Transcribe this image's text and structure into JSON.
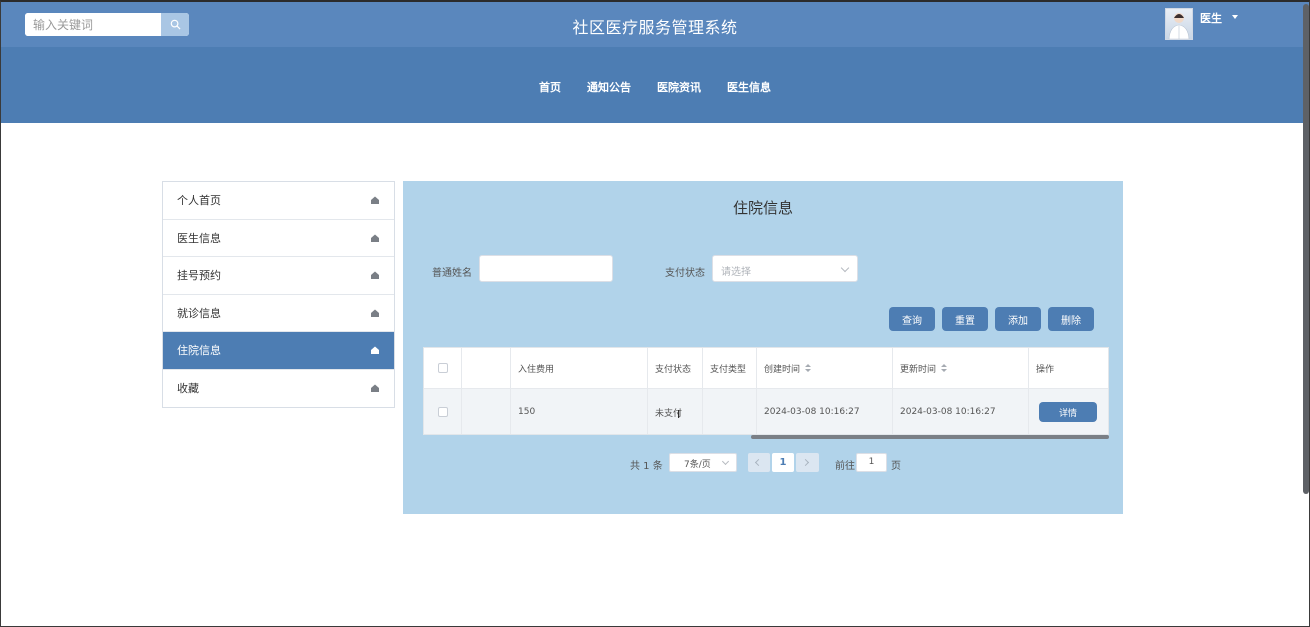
{
  "header": {
    "search_placeholder": "输入关键词",
    "site_title": "社区医疗服务管理系统",
    "user_name": "医生"
  },
  "nav": {
    "items": [
      "首页",
      "通知公告",
      "医院资讯",
      "医生信息"
    ]
  },
  "sidebar": {
    "items": [
      {
        "label": "个人首页",
        "active": false
      },
      {
        "label": "医生信息",
        "active": false
      },
      {
        "label": "挂号预约",
        "active": false
      },
      {
        "label": "就诊信息",
        "active": false
      },
      {
        "label": "住院信息",
        "active": true
      },
      {
        "label": "收藏",
        "active": false
      }
    ]
  },
  "main": {
    "title": "住院信息",
    "filters": {
      "name_label": "普通姓名",
      "name_value": "",
      "status_label": "支付状态",
      "status_placeholder": "请选择"
    },
    "buttons": {
      "query": "查询",
      "reset": "重置",
      "add": "添加",
      "delete": "删除"
    },
    "table": {
      "headers": [
        "入住费用",
        "支付状态",
        "支付类型",
        "创建时间",
        "更新时间",
        "操作"
      ],
      "rows": [
        {
          "cost": "150",
          "pay_status": "未支付",
          "pay_type": "",
          "created": "2024-03-08 10:16:27",
          "updated": "2024-03-08 10:16:27",
          "action": "详情"
        }
      ]
    },
    "pagination": {
      "total": "共 1 条",
      "page_size": "7条/页",
      "current_page": "1",
      "goto_label": "前往",
      "goto_value": "1",
      "page_suffix": "页"
    }
  },
  "colors": {
    "topbar": "#5a87bd",
    "navbar": "#4d7db3",
    "content_bg": "#b1d3ea",
    "accent": "#4d7db3"
  }
}
